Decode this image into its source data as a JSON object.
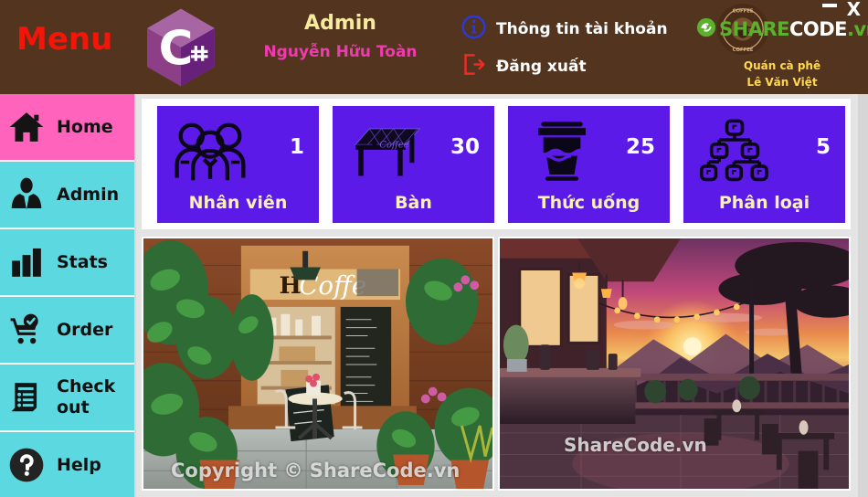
{
  "window": {
    "close_label": "X",
    "minimize_label": "—"
  },
  "header": {
    "menu_label": "Menu",
    "logo_icon": "csharp-logo-icon",
    "logo_text": "C",
    "logo_sharp": "#",
    "user": {
      "role": "Admin",
      "name": "Nguyễn Hữu Toàn"
    },
    "actions": [
      {
        "label": "Thông tin tài khoản",
        "icon": "info-circle-icon",
        "color": "#2a38e8"
      },
      {
        "label": "Đăng xuất",
        "icon": "logout-icon",
        "color": "#ef2b23"
      }
    ],
    "brand": {
      "seal_icon": "coffee-seal-icon",
      "seal_top_text": "COFFEE",
      "seal_bottom_text": "COFFEE",
      "watermark_share": "SHARE",
      "watermark_code": "CODE",
      "watermark_vn": ".vn",
      "shop_line1": "Quán cà phê",
      "shop_line2": "Lê Văn Việt"
    },
    "background_color": "#53341f",
    "menu_color": "#f51408",
    "role_color": "#f5eaa0",
    "name_color": "#ef3ab0"
  },
  "sidebar": {
    "active_index": 0,
    "active_color": "#ff63bc",
    "inactive_color": "#5cd9e0",
    "items": [
      {
        "label": "Home",
        "icon": "home-icon"
      },
      {
        "label": "Admin",
        "icon": "user-tie-icon"
      },
      {
        "label": "Stats",
        "icon": "bar-chart-icon"
      },
      {
        "label": "Order",
        "icon": "cart-check-icon"
      },
      {
        "label": "Check out",
        "icon": "receipt-list-icon"
      },
      {
        "label": "Help",
        "icon": "question-circle-icon"
      }
    ]
  },
  "stats": {
    "card_color": "#5b1ae8",
    "label_color": "#fbf0b6",
    "number_color": "#ffffff",
    "cards": [
      {
        "label": "Nhân viên",
        "value": "1",
        "icon": "people-group-icon"
      },
      {
        "label": "Bàn",
        "value": "30",
        "icon": "table-furniture-icon"
      },
      {
        "label": "Thức uống",
        "value": "25",
        "icon": "coffee-cup-icon"
      },
      {
        "label": "Phân loại",
        "value": "5",
        "icon": "hierarchy-category-icon"
      }
    ]
  },
  "gallery": {
    "images": [
      {
        "alt": "coffee-shop-storefront-illustration",
        "sign_text": "H Coffe",
        "watermark": "Copyright © ShareCode.vn"
      },
      {
        "alt": "sunset-terrace-cafe-illustration",
        "watermark": "ShareCode.vn"
      }
    ]
  }
}
